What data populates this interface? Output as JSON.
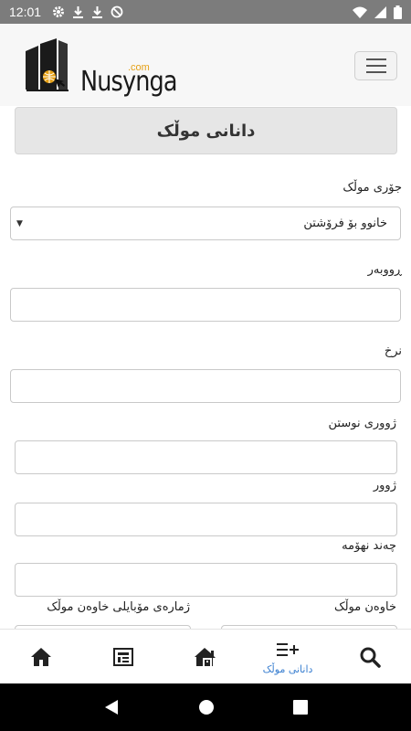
{
  "status_bar": {
    "time": "12:01",
    "left_icons": [
      "gear-icon",
      "download-icon",
      "download-icon",
      "no-sync-icon"
    ],
    "right_icons": [
      "wifi-icon",
      "signal-icon",
      "battery-icon"
    ]
  },
  "header": {
    "logo_text": "Nusynga",
    "logo_suffix": ".com",
    "menu_icon": "hamburger-icon"
  },
  "page": {
    "title": "دانانی موڵک"
  },
  "form": {
    "property_type": {
      "label": "جۆری موڵک",
      "value": "خانوو بۆ فرۆشتن"
    },
    "area": {
      "label": "ڕووبەر",
      "value": ""
    },
    "price": {
      "label": "نرخ",
      "value": ""
    },
    "bedrooms": {
      "label": "ژووری نوستن",
      "value": ""
    },
    "rooms": {
      "label": "ژوور",
      "value": ""
    },
    "floors": {
      "label": "چەند نهۆمە",
      "value": ""
    },
    "owner": {
      "label": "خاوەن موڵک",
      "value": ""
    },
    "owner_phone": {
      "label": "ژمارەی مۆبایلی خاوەن موڵک",
      "value": ""
    }
  },
  "bottom_nav": {
    "items": [
      {
        "icon": "home-icon",
        "label": ""
      },
      {
        "icon": "listings-icon",
        "label": ""
      },
      {
        "icon": "house-building-icon",
        "label": ""
      },
      {
        "icon": "add-list-icon",
        "label": "دانانی موڵک",
        "active": true
      },
      {
        "icon": "search-icon",
        "label": ""
      }
    ],
    "active_color": "#3a7fd0"
  },
  "system_nav": [
    "back-icon",
    "home-circle-icon",
    "recents-icon"
  ]
}
